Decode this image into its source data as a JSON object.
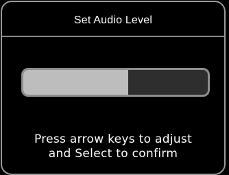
{
  "dialog": {
    "title": "Set Audio Level",
    "level": {
      "fraction": 0.57,
      "fill_color": "#bdbdbd",
      "track_color": "#2e2e2e"
    },
    "instructions": {
      "line1": "Press arrow keys to adjust",
      "line2": "and Select to confirm"
    }
  }
}
